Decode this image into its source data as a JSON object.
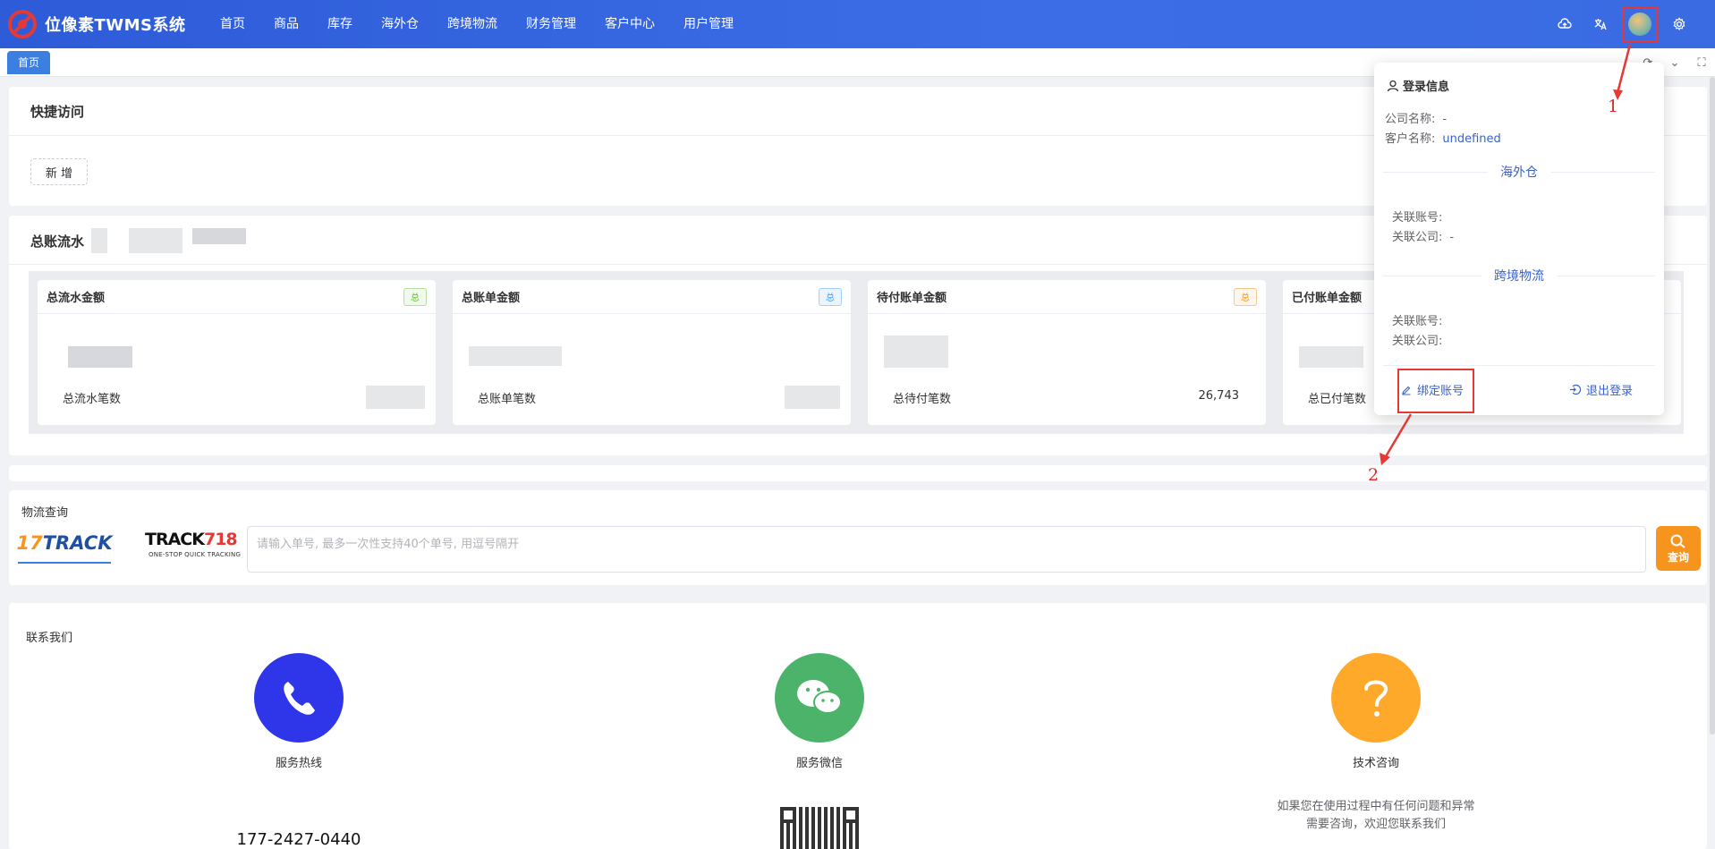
{
  "app": {
    "title": "位像素TWMS系统"
  },
  "nav": [
    {
      "label": "首页"
    },
    {
      "label": "商品"
    },
    {
      "label": "库存"
    },
    {
      "label": "海外仓"
    },
    {
      "label": "跨境物流"
    },
    {
      "label": "财务管理"
    },
    {
      "label": "客户中心"
    },
    {
      "label": "用户管理"
    }
  ],
  "topbar_icons": [
    "cloud-upload-icon",
    "translate-icon",
    "avatar",
    "gear-icon"
  ],
  "tabs": [
    {
      "label": "首页",
      "active": true
    }
  ],
  "quick_access": {
    "title": "快捷访问",
    "add_label": "新 增"
  },
  "ledger": {
    "title": "总账流水",
    "cards": [
      {
        "title": "总流水金额",
        "badge": "总",
        "badge_color": "#67c23a",
        "count_label": "总流水笔数",
        "count_value": ""
      },
      {
        "title": "总账单金额",
        "badge": "总",
        "badge_color": "#409eff",
        "count_label": "总账单笔数",
        "count_value": ""
      },
      {
        "title": "待付账单金额",
        "badge": "总",
        "badge_color": "#f7941d",
        "count_label": "总待付笔数",
        "count_value": "26,743"
      },
      {
        "title": "已付账单金额",
        "badge": "",
        "badge_color": "",
        "count_label": "总已付笔数",
        "count_value": ""
      }
    ]
  },
  "logistics": {
    "title": "物流查询",
    "providers": [
      {
        "name_num": "17",
        "name_txt": "TRACK"
      },
      {
        "name_main": "TRACK",
        "name_red": "718",
        "tagline": "ONE-STOP QUICK TRACKING"
      }
    ],
    "placeholder": "请输入单号, 最多一次性支持40个单号, 用逗号隔开",
    "button_label": "查询"
  },
  "contact": {
    "title": "联系我们",
    "items": [
      {
        "label": "服务热线",
        "icon": "phone-icon",
        "color": "#2f35e8",
        "detail": "177-2427-0440"
      },
      {
        "label": "服务微信",
        "icon": "wechat-icon",
        "color": "#4cb36b",
        "detail": ""
      },
      {
        "label": "技术咨询",
        "icon": "question-icon",
        "color": "#ffa92b",
        "detail": "如果您在使用过程中有任何问题和异常 需要咨询，欢迎您联系我们"
      }
    ],
    "tech_note_1": "如果您在使用过程中有任何问题和异常",
    "tech_note_2": "需要咨询，欢迎您联系我们"
  },
  "login_popover": {
    "title": "登录信息",
    "company_label": "公司名称:",
    "company_value": "-",
    "customer_label": "客户名称:",
    "customer_value": "undefined",
    "section_overseas": "海外仓",
    "overseas_account_label": "关联账号:",
    "overseas_account_value": "",
    "overseas_company_label": "关联公司:",
    "overseas_company_value": "-",
    "section_logistics": "跨境物流",
    "logistics_account_label": "关联账号:",
    "logistics_account_value": "",
    "logistics_company_label": "关联公司:",
    "logistics_company_value": "",
    "bind_label": "绑定账号",
    "logout_label": "退出登录"
  },
  "annotations": {
    "marker_1": "1",
    "marker_2": "2"
  }
}
